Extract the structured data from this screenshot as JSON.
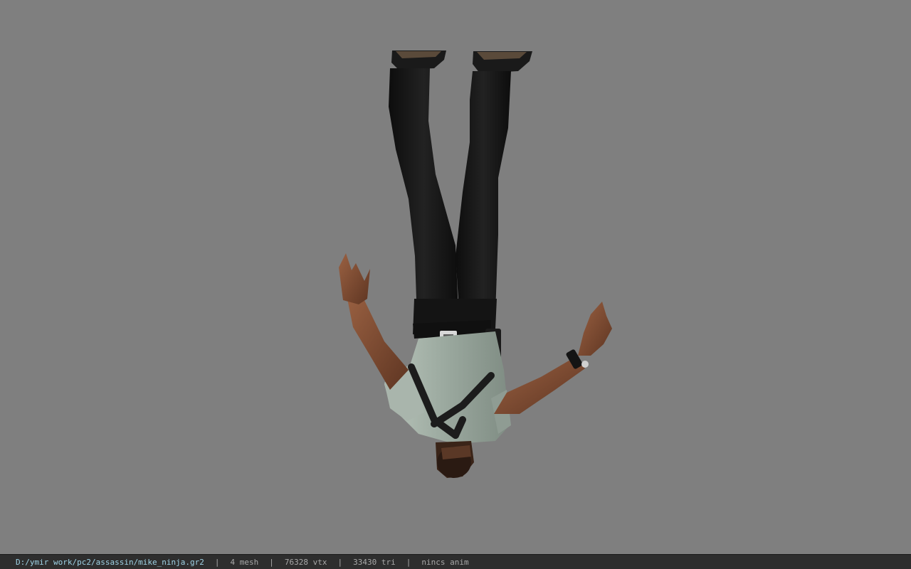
{
  "status_bar": {
    "file_path": "D:/ymir work/pc2/assassin/mike_ninja.gr2",
    "separator": "|",
    "mesh_count": "4 mesh",
    "vertex_count": "76328 vtx",
    "triangle_count": "33430 tri",
    "animation": "nincs anim"
  },
  "colors": {
    "viewport_background": "#7f7f7f",
    "status_bar_background": "#2e2e2e",
    "path_text": "#9fd3e6",
    "stat_text": "#a8a8a8",
    "skin": "#7a4a30",
    "pants": "#151515",
    "shirt": "#9aa89e",
    "harness": "#1c1c1c"
  },
  "viewport": {
    "model": "upside-down-character-model"
  }
}
